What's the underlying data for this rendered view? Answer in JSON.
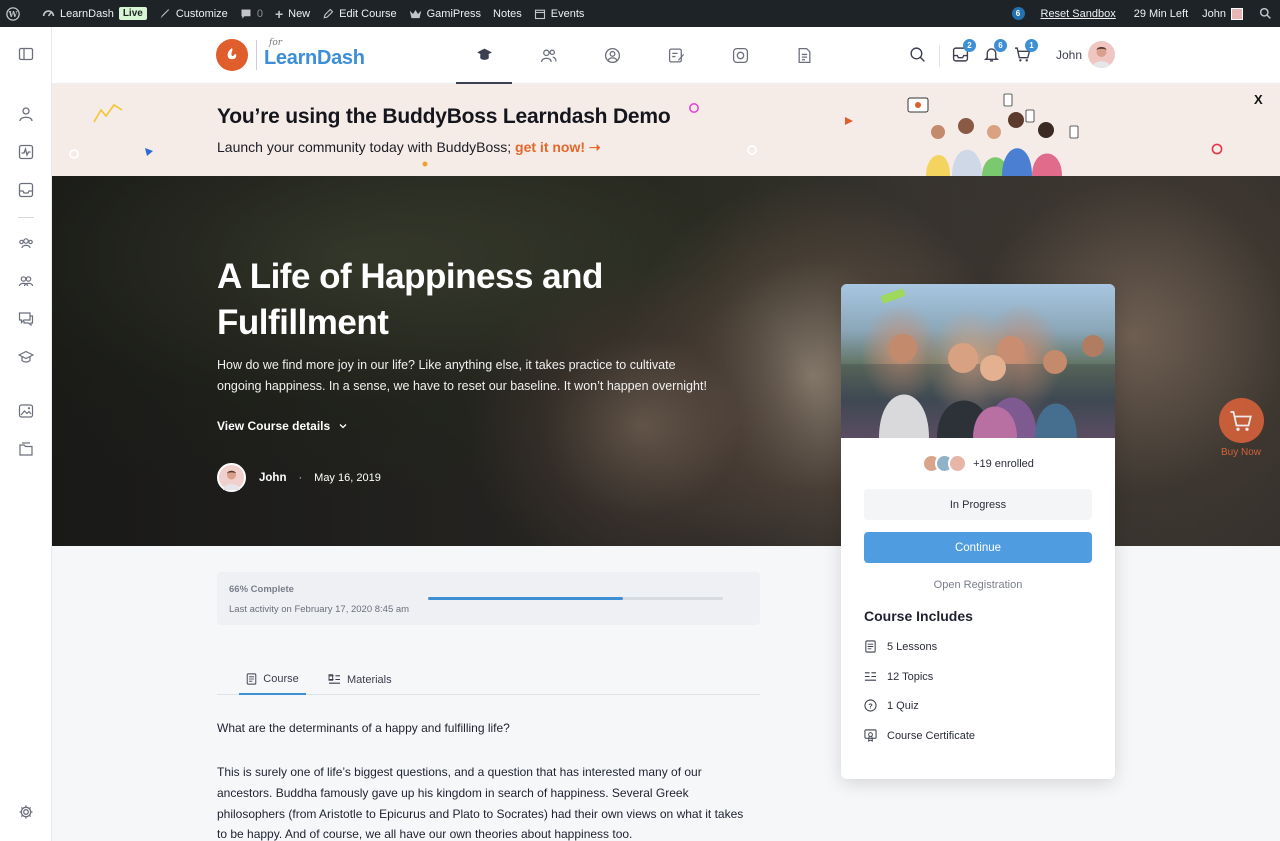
{
  "adminbar": {
    "site_name": "LearnDash",
    "live_badge": "Live",
    "customize": "Customize",
    "comments_count": "0",
    "new_label": "New",
    "edit_course": "Edit Course",
    "gamipress": "GamiPress",
    "notes": "Notes",
    "events": "Events",
    "notif_count": "6",
    "reset_sandbox": "Reset Sandbox",
    "time_left": "29 Min Left",
    "user": "John"
  },
  "header": {
    "logo_for": "for",
    "logo_name": "LearnDash",
    "messages_count": "2",
    "notifications_count": "6",
    "cart_count": "1",
    "user_name": "John"
  },
  "banner": {
    "title": "You’re using the BuddyBoss Learndash Demo",
    "subtitle": "Launch your community today with BuddyBoss;",
    "cta": "get it now! ➝",
    "close": "X"
  },
  "hero": {
    "title": "A Life of Happiness and Fulfillment",
    "description": "How do we find more joy in our life? Like anything else, it takes practice to cultivate ongoing happiness. In a sense, we have to reset our baseline. It won’t happen overnight!",
    "details_toggle": "View Course details",
    "author": "John",
    "date": "May 16, 2019",
    "buy_now": "Buy Now"
  },
  "progress": {
    "percent_label": "66% Complete",
    "percent_value": 66,
    "last_activity": "Last activity on February 17, 2020 8:45 am"
  },
  "tabs": {
    "course": "Course",
    "materials": "Materials"
  },
  "content": {
    "question": "What are the determinants of a happy and fulfilling life?",
    "paragraph": "This is surely one of life’s biggest questions, and a question that has interested many of our ancestors. Buddha famously gave up his kingdom in search of happiness. Several Greek philosophers (from Aristotle to Epicurus and Plato to Socrates) had their own views on what it takes to be happy. And of course, we all have our own theories about happiness too."
  },
  "card": {
    "enrolled": "+19 enrolled",
    "status": "In Progress",
    "continue": "Continue",
    "open_registration": "Open Registration",
    "includes_title": "Course Includes",
    "includes": [
      {
        "label": "5 Lessons",
        "icon": "lessons-icon"
      },
      {
        "label": "12 Topics",
        "icon": "topics-icon"
      },
      {
        "label": "1 Quiz",
        "icon": "quiz-icon"
      },
      {
        "label": "Course Certificate",
        "icon": "certificate-icon"
      }
    ]
  },
  "colors": {
    "accent": "#3d8fd6",
    "brand_orange": "#e4672c",
    "adminbar": "#1d2327"
  }
}
